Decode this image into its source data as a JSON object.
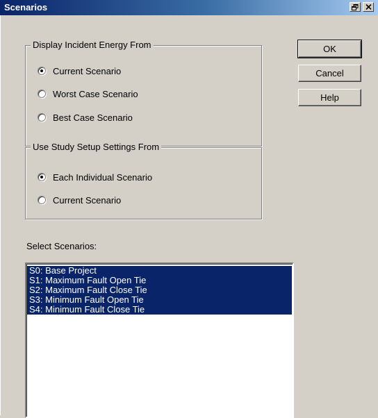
{
  "window": {
    "title": "Scenarios",
    "controls": [
      "restore-icon",
      "close-icon"
    ]
  },
  "group_incident": {
    "legend": "Display Incident Energy From",
    "options": [
      {
        "label": "Current Scenario",
        "checked": true
      },
      {
        "label": "Worst Case Scenario",
        "checked": false
      },
      {
        "label": "Best Case Scenario",
        "checked": false
      }
    ]
  },
  "group_setup": {
    "legend": "Use Study Setup Settings From",
    "options": [
      {
        "label": "Each Individual Scenario",
        "checked": true
      },
      {
        "label": "Current Scenario",
        "checked": false
      }
    ]
  },
  "buttons": {
    "ok": "OK",
    "cancel": "Cancel",
    "help": "Help"
  },
  "scenario_list": {
    "label": "Select Scenarios:",
    "items": [
      {
        "label": "S0:  Base Project",
        "selected": true
      },
      {
        "label": "S1:  Maximum Fault Open Tie",
        "selected": true
      },
      {
        "label": "S2:  Maximum Fault Close Tie",
        "selected": true
      },
      {
        "label": "S3:  Minimum Fault Open Tie",
        "selected": true
      },
      {
        "label": "S4:  Minimum Fault Close Tie",
        "selected": true
      }
    ]
  },
  "colors": {
    "face": "#d4d0c8",
    "title_start": "#0a246a",
    "title_end": "#a6caf0",
    "selection": "#0a246a"
  }
}
